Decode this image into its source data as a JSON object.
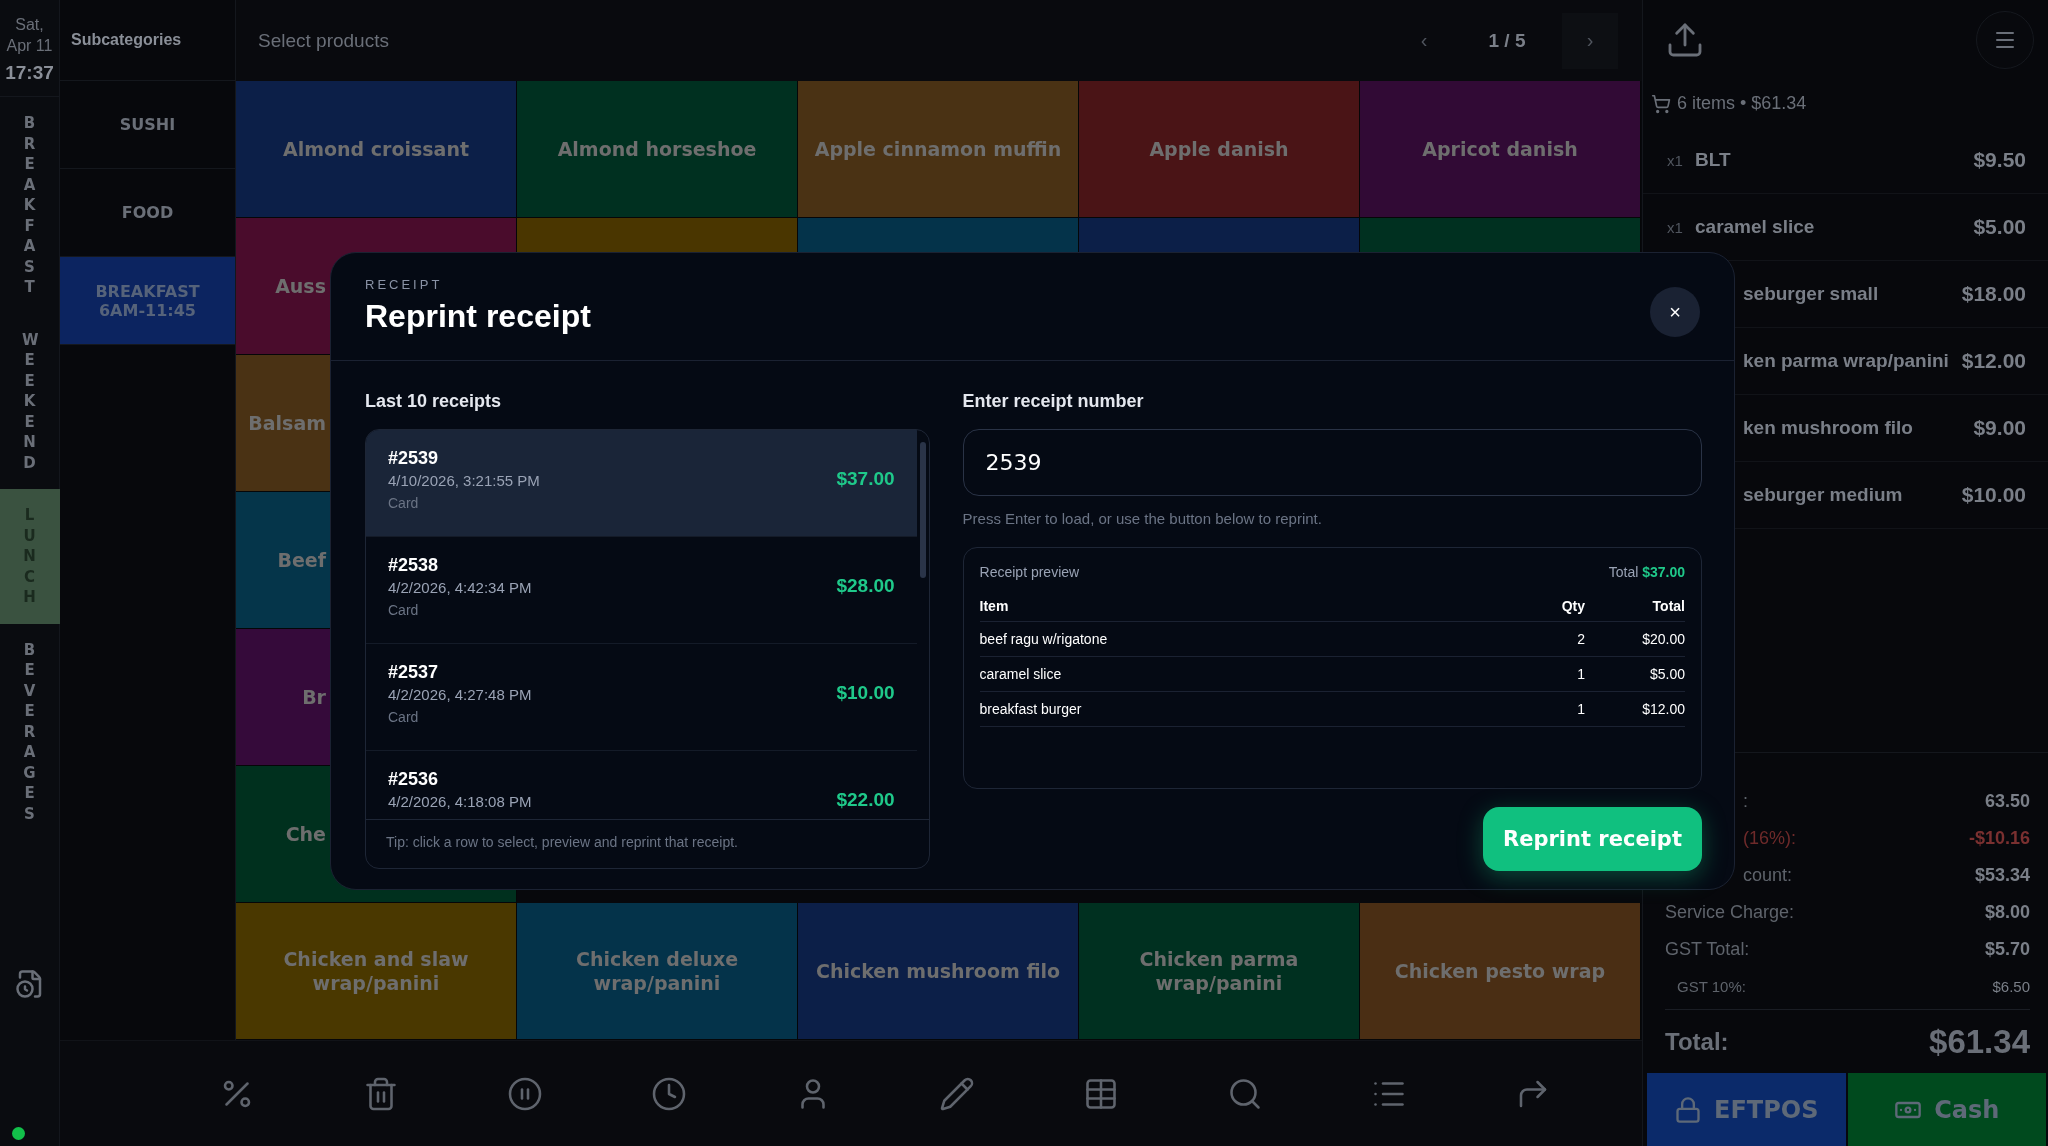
{
  "clock": {
    "date": "Sat, Apr 11",
    "time": "17:37"
  },
  "categories": [
    {
      "label": "BREAKFAST",
      "selected": false
    },
    {
      "label": "WEEKEND",
      "selected": false
    },
    {
      "label": "LUNCH",
      "selected": true
    },
    {
      "label": "BEVERAGES",
      "selected": false
    }
  ],
  "subcategories": {
    "title": "Subcategories",
    "items": [
      {
        "label": "SUSHI",
        "selected": false
      },
      {
        "label": "FOOD",
        "selected": false
      },
      {
        "label": "BREAKFAST 6AM-11:45",
        "selected": true
      }
    ]
  },
  "products": {
    "title": "Select products",
    "prev": "‹",
    "page": "1 / 5",
    "next": "›",
    "rows": [
      [
        {
          "label": "Almond croissant",
          "color": "#0c1f48"
        },
        {
          "label": "Almond horseshoe",
          "color": "#003020"
        },
        {
          "label": "Apple cinnamon muffin",
          "color": "#4a3214"
        },
        {
          "label": "Apple danish",
          "color": "#4a1416"
        },
        {
          "label": "Apricot danish",
          "color": "#310a35"
        }
      ],
      [
        {
          "label": "Auss",
          "color": "#4a0c2c",
          "partial": true
        },
        {
          "color": "#4a3600"
        },
        {
          "color": "#04334a"
        },
        {
          "color": "#0c1f48"
        },
        {
          "color": "#003020"
        }
      ],
      [
        {
          "label": "Balsam",
          "color": "#4a3214",
          "partial": true
        }
      ],
      [
        {
          "label": "Beef",
          "color": "#05354a",
          "partial": true
        }
      ],
      [
        {
          "label": "Br",
          "color": "#350a3a",
          "partial": true
        }
      ],
      [
        {
          "label": "Che",
          "color": "#00301e",
          "partial": true
        }
      ],
      [
        {
          "label": "Chicken and slaw wrap/panini",
          "color": "#4a3800"
        },
        {
          "label": "Chicken deluxe wrap/panini",
          "color": "#04334a"
        },
        {
          "label": "Chicken mushroom filo",
          "color": "#0c1f48"
        },
        {
          "label": "Chicken parma wrap/panini",
          "color": "#003020"
        },
        {
          "label": "Chicken pesto wrap",
          "color": "#4a2e14"
        }
      ]
    ]
  },
  "order": {
    "summary": "6 items • $61.34",
    "items": [
      {
        "qty": "x1",
        "name": "BLT",
        "price": "$9.50"
      },
      {
        "qty": "x1",
        "name": "caramel slice",
        "price": "$5.00"
      },
      {
        "name": "seburger small",
        "price": "$18.00",
        "partial": true
      },
      {
        "name": "ken parma wrap/panini",
        "price": "$12.00",
        "partial": true
      },
      {
        "name": "ken mushroom filo",
        "price": "$9.00",
        "partial": true
      },
      {
        "name": "seburger medium",
        "price": "$10.00",
        "partial": true
      }
    ],
    "totals": [
      {
        "label": ":",
        "value": "63.50",
        "kind": "plain",
        "partial": true
      },
      {
        "label": "(16%):",
        "value": "-$10.16",
        "kind": "discount",
        "partial": true
      },
      {
        "label": "count:",
        "value": "$53.34",
        "kind": "plain",
        "partial": true
      },
      {
        "label": "Service Charge:",
        "value": "$8.00",
        "kind": "plain"
      },
      {
        "label": "GST Total:",
        "value": "$5.70",
        "kind": "plain"
      },
      {
        "label": "GST 10%:",
        "value": "$6.50",
        "kind": "sub"
      }
    ],
    "total": {
      "label": "Total:",
      "value": "$61.34"
    },
    "payments": [
      {
        "label": "EFTPOS",
        "kind": "card"
      },
      {
        "label": "Cash",
        "kind": "cash"
      }
    ]
  },
  "dialog": {
    "eyebrow": "RECEIPT",
    "title": "Reprint receipt",
    "close": "×",
    "list_title": "Last 10 receipts",
    "receipts": [
      {
        "number": "#2539",
        "date": "4/10/2026, 3:21:55 PM",
        "method": "Card",
        "amount": "$37.00",
        "selected": true
      },
      {
        "number": "#2538",
        "date": "4/2/2026, 4:42:34 PM",
        "method": "Card",
        "amount": "$28.00",
        "selected": false
      },
      {
        "number": "#2537",
        "date": "4/2/2026, 4:27:48 PM",
        "method": "Card",
        "amount": "$10.00",
        "selected": false
      },
      {
        "number": "#2536",
        "date": "4/2/2026, 4:18:08 PM",
        "amount": "$22.00",
        "selected": false
      }
    ],
    "tip": "Tip: click a row to select, preview and reprint that receipt.",
    "field_label": "Enter receipt number",
    "field_value": "2539",
    "hint": "Press Enter to load, or use the button below to reprint.",
    "preview": {
      "title": "Receipt preview",
      "total_label": "Total",
      "total_value": "$37.00",
      "columns": [
        "Item",
        "Qty",
        "Total"
      ],
      "rows": [
        [
          "beef ragu w/rigatone",
          "2",
          "$20.00"
        ],
        [
          "caramel slice",
          "1",
          "$5.00"
        ],
        [
          "breakfast burger",
          "1",
          "$12.00"
        ]
      ]
    },
    "button": "Reprint receipt"
  }
}
